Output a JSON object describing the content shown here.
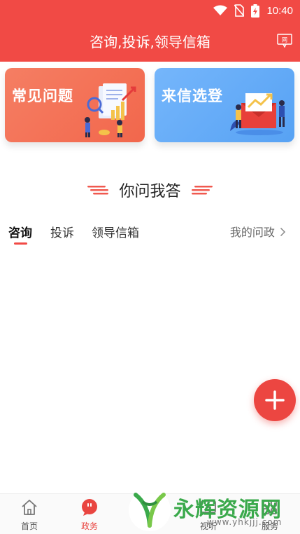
{
  "status": {
    "time": "10:40"
  },
  "header": {
    "title": "咨询,投诉,领导信箱",
    "message_icon_text": "网"
  },
  "cards": [
    {
      "label": "常见问题"
    },
    {
      "label": "来信选登"
    }
  ],
  "section": {
    "title": "你问我答"
  },
  "tabs": [
    {
      "label": "咨询",
      "active": true
    },
    {
      "label": "投诉",
      "active": false
    },
    {
      "label": "领导信箱",
      "active": false
    }
  ],
  "my_questions": {
    "label": "我的问政"
  },
  "bottom_nav": [
    {
      "label": "首页",
      "icon": "home-icon",
      "active": false
    },
    {
      "label": "政务",
      "icon": "chat-icon",
      "active": true
    },
    {
      "label": "视听",
      "icon": "play-icon",
      "active": false
    },
    {
      "label": "服务",
      "icon": "grid-icon",
      "active": false
    }
  ],
  "watermark": {
    "brand": "永辉资源网",
    "url": "www.yhkjjj.com"
  },
  "colors": {
    "primary": "#f14a45",
    "faq_card": "#f36d51",
    "letter_card": "#63a9f6"
  }
}
